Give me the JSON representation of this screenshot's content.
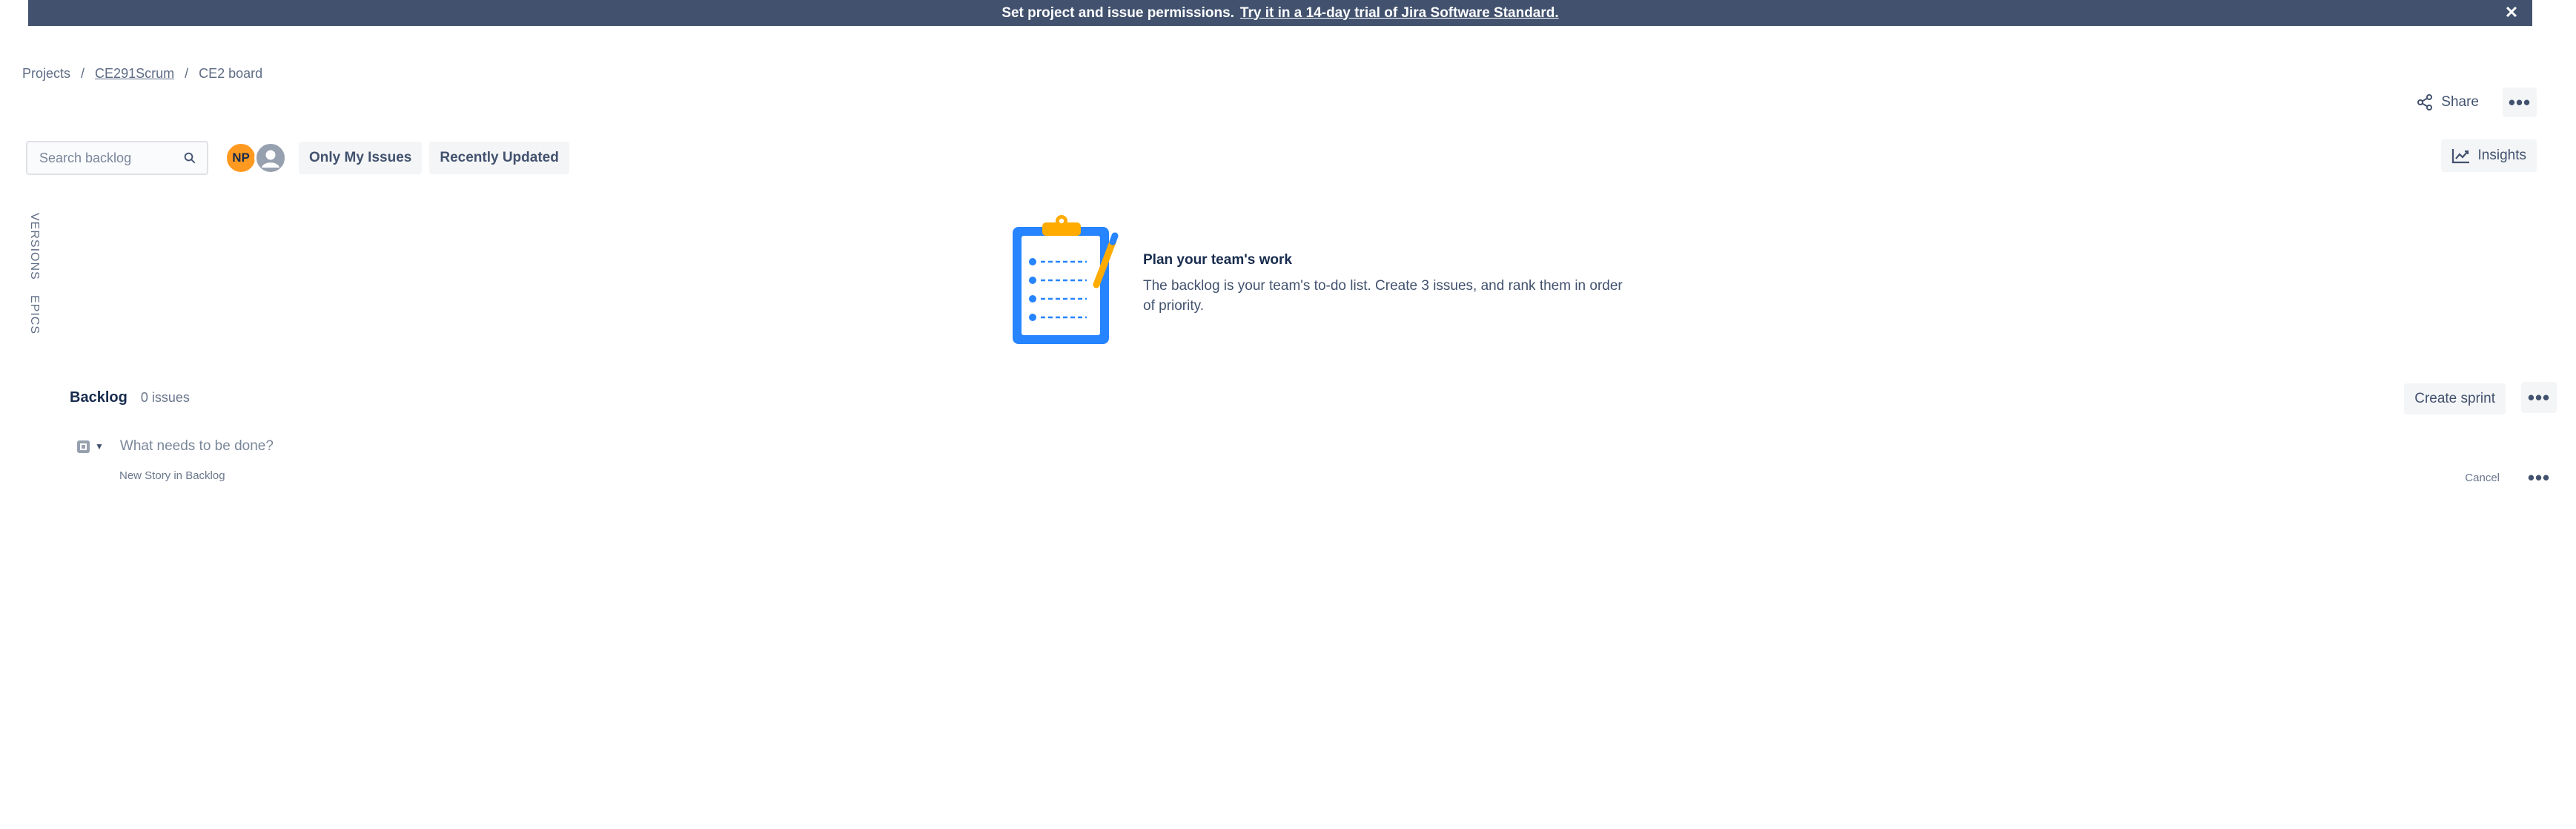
{
  "banner": {
    "message": "Set project and issue permissions.",
    "link": "Try it in a 14-day trial of Jira Software Standard.",
    "close_icon": "close-icon"
  },
  "breadcrumb": {
    "items": [
      "Projects",
      "CE291Scrum",
      "CE2 board"
    ],
    "separator": "/"
  },
  "header_actions": {
    "share_label": "Share",
    "share_icon": "share-icon",
    "more_icon": "more-horizontal-icon",
    "insights_label": "Insights",
    "insights_icon": "chart-line-icon"
  },
  "toolbar": {
    "search_placeholder": "Search backlog",
    "avatar_initials": "NP",
    "filters": [
      "Only My Issues",
      "Recently Updated"
    ]
  },
  "side_tabs": [
    "VERSIONS",
    "EPICS"
  ],
  "empty_state": {
    "title": "Plan your team's work",
    "description": "The backlog is your team's to-do list. Create 3 issues, and rank them in order of priority."
  },
  "backlog": {
    "title": "Backlog",
    "count": "0 issues",
    "create_sprint_label": "Create sprint"
  },
  "create_issue": {
    "placeholder": "What needs to be done?",
    "hint": "New Story in Backlog",
    "cancel_label": "Cancel"
  },
  "colors": {
    "banner_bg": "#42526e",
    "avatar_np": "#ff991f",
    "clipboard_blue": "#2684ff",
    "clipboard_clip": "#ffab00"
  }
}
